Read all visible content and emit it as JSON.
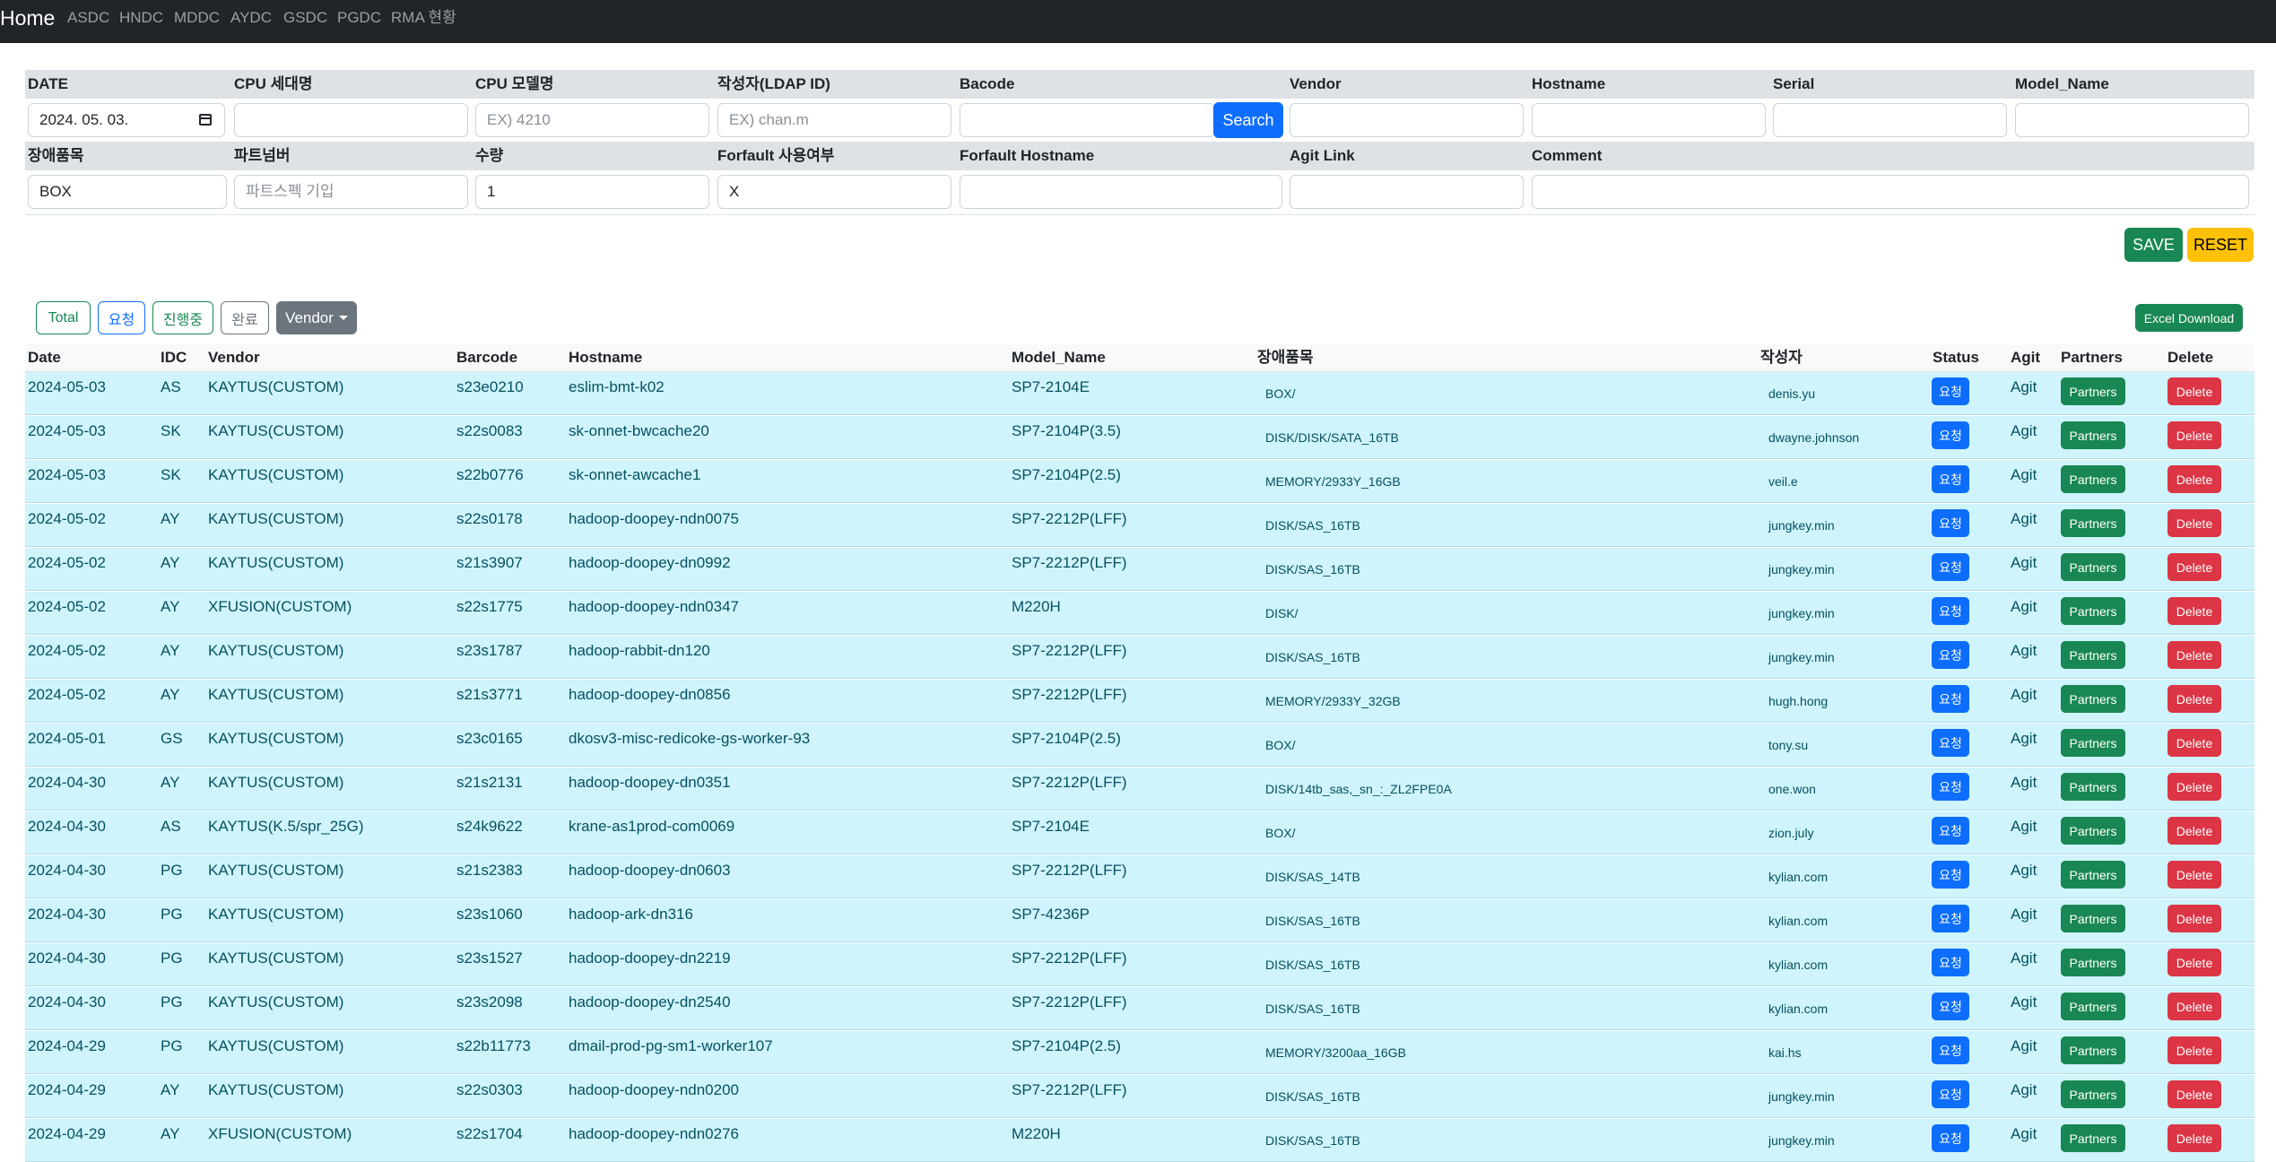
{
  "nav": {
    "home": "Home",
    "links": [
      "ASDC",
      "HNDC",
      "MDDC",
      "AYDC",
      "GSDC",
      "PGDC",
      "RMA 현황"
    ]
  },
  "form": {
    "row1": {
      "date": {
        "label": "DATE",
        "value": "2024. 05. 03."
      },
      "cpu_gen": {
        "label": "CPU 세대명",
        "value": "",
        "placeholder": ""
      },
      "cpu_model": {
        "label": "CPU 모델명",
        "value": "",
        "placeholder": "EX) 4210"
      },
      "author": {
        "label": "작성자(LDAP ID)",
        "value": "",
        "placeholder": "EX) chan.m"
      },
      "barcode": {
        "label": "Bacode",
        "value": "",
        "placeholder": ""
      },
      "vendor": {
        "label": "Vendor",
        "value": "",
        "placeholder": ""
      },
      "hostname": {
        "label": "Hostname",
        "value": "",
        "placeholder": ""
      },
      "serial": {
        "label": "Serial",
        "value": "",
        "placeholder": ""
      },
      "model_name": {
        "label": "Model_Name",
        "value": "",
        "placeholder": ""
      }
    },
    "row2": {
      "fault_item": {
        "label": "장애품목",
        "value": "BOX"
      },
      "part_number": {
        "label": "파트넘버",
        "value": "",
        "placeholder": "파트스펙 기입"
      },
      "quantity": {
        "label": "수량",
        "value": "1"
      },
      "forfault_use": {
        "label": "Forfault 사용여부",
        "value": "X"
      },
      "forfault_hostname": {
        "label": "Forfault Hostname",
        "value": "",
        "placeholder": ""
      },
      "agit_link": {
        "label": "Agit Link",
        "value": "",
        "placeholder": ""
      },
      "comment": {
        "label": "Comment",
        "value": "",
        "placeholder": ""
      }
    },
    "search_button": "Search",
    "save_button": "SAVE",
    "reset_button": "RESET"
  },
  "filters": {
    "total": "Total",
    "requested": "요청",
    "in_progress": "진행중",
    "done": "완료",
    "vendor": "Vendor",
    "excel": "Excel Download"
  },
  "table": {
    "headers": {
      "date": "Date",
      "idc": "IDC",
      "vendor": "Vendor",
      "barcode": "Barcode",
      "hostname": "Hostname",
      "model": "Model_Name",
      "fault": "장애품목",
      "author": "작성자",
      "status": "Status",
      "agit": "Agit",
      "partners": "Partners",
      "delete": "Delete"
    },
    "rows": [
      {
        "date": "2024-05-03",
        "idc": "AS",
        "vendor": "KAYTUS(CUSTOM)",
        "barcode": "s23e0210",
        "hostname": "eslim-bmt-k02",
        "model": "SP7-2104E",
        "fault": "BOX/",
        "author": "denis.yu",
        "status": "요청",
        "agit": "Agit",
        "partners": "Partners",
        "delete": "Delete"
      },
      {
        "date": "2024-05-03",
        "idc": "SK",
        "vendor": "KAYTUS(CUSTOM)",
        "barcode": "s22s0083",
        "hostname": "sk-onnet-bwcache20",
        "model": "SP7-2104P(3.5)",
        "fault": "DISK/DISK/SATA_16TB",
        "author": "dwayne.johnson",
        "status": "요청",
        "agit": "Agit",
        "partners": "Partners",
        "delete": "Delete"
      },
      {
        "date": "2024-05-03",
        "idc": "SK",
        "vendor": "KAYTUS(CUSTOM)",
        "barcode": "s22b0776",
        "hostname": "sk-onnet-awcache1",
        "model": "SP7-2104P(2.5)",
        "fault": "MEMORY/2933Y_16GB",
        "author": "veil.e",
        "status": "요청",
        "agit": "Agit",
        "partners": "Partners",
        "delete": "Delete"
      },
      {
        "date": "2024-05-02",
        "idc": "AY",
        "vendor": "KAYTUS(CUSTOM)",
        "barcode": "s22s0178",
        "hostname": "hadoop-doopey-ndn0075",
        "model": "SP7-2212P(LFF)",
        "fault": "DISK/SAS_16TB",
        "author": "jungkey.min",
        "status": "요청",
        "agit": "Agit",
        "partners": "Partners",
        "delete": "Delete"
      },
      {
        "date": "2024-05-02",
        "idc": "AY",
        "vendor": "KAYTUS(CUSTOM)",
        "barcode": "s21s3907",
        "hostname": "hadoop-doopey-dn0992",
        "model": "SP7-2212P(LFF)",
        "fault": "DISK/SAS_16TB",
        "author": "jungkey.min",
        "status": "요청",
        "agit": "Agit",
        "partners": "Partners",
        "delete": "Delete"
      },
      {
        "date": "2024-05-02",
        "idc": "AY",
        "vendor": "XFUSION(CUSTOM)",
        "barcode": "s22s1775",
        "hostname": "hadoop-doopey-ndn0347",
        "model": "M220H",
        "fault": "DISK/",
        "author": "jungkey.min",
        "status": "요청",
        "agit": "Agit",
        "partners": "Partners",
        "delete": "Delete"
      },
      {
        "date": "2024-05-02",
        "idc": "AY",
        "vendor": "KAYTUS(CUSTOM)",
        "barcode": "s23s1787",
        "hostname": "hadoop-rabbit-dn120",
        "model": "SP7-2212P(LFF)",
        "fault": "DISK/SAS_16TB",
        "author": "jungkey.min",
        "status": "요청",
        "agit": "Agit",
        "partners": "Partners",
        "delete": "Delete"
      },
      {
        "date": "2024-05-02",
        "idc": "AY",
        "vendor": "KAYTUS(CUSTOM)",
        "barcode": "s21s3771",
        "hostname": "hadoop-doopey-dn0856",
        "model": "SP7-2212P(LFF)",
        "fault": "MEMORY/2933Y_32GB",
        "author": "hugh.hong",
        "status": "요청",
        "agit": "Agit",
        "partners": "Partners",
        "delete": "Delete"
      },
      {
        "date": "2024-05-01",
        "idc": "GS",
        "vendor": "KAYTUS(CUSTOM)",
        "barcode": "s23c0165",
        "hostname": "dkosv3-misc-redicoke-gs-worker-93",
        "model": "SP7-2104P(2.5)",
        "fault": "BOX/",
        "author": "tony.su",
        "status": "요청",
        "agit": "Agit",
        "partners": "Partners",
        "delete": "Delete"
      },
      {
        "date": "2024-04-30",
        "idc": "AY",
        "vendor": "KAYTUS(CUSTOM)",
        "barcode": "s21s2131",
        "hostname": "hadoop-doopey-dn0351",
        "model": "SP7-2212P(LFF)",
        "fault": "DISK/14tb_sas,_sn_:_ZL2FPE0A",
        "author": "one.won",
        "status": "요청",
        "agit": "Agit",
        "partners": "Partners",
        "delete": "Delete"
      },
      {
        "date": "2024-04-30",
        "idc": "AS",
        "vendor": "KAYTUS(K.5/spr_25G)",
        "barcode": "s24k9622",
        "hostname": "krane-as1prod-com0069",
        "model": "SP7-2104E",
        "fault": "BOX/",
        "author": "zion.july",
        "status": "요청",
        "agit": "Agit",
        "partners": "Partners",
        "delete": "Delete"
      },
      {
        "date": "2024-04-30",
        "idc": "PG",
        "vendor": "KAYTUS(CUSTOM)",
        "barcode": "s21s2383",
        "hostname": "hadoop-doopey-dn0603",
        "model": "SP7-2212P(LFF)",
        "fault": "DISK/SAS_14TB",
        "author": "kylian.com",
        "status": "요청",
        "agit": "Agit",
        "partners": "Partners",
        "delete": "Delete"
      },
      {
        "date": "2024-04-30",
        "idc": "PG",
        "vendor": "KAYTUS(CUSTOM)",
        "barcode": "s23s1060",
        "hostname": "hadoop-ark-dn316",
        "model": "SP7-4236P",
        "fault": "DISK/SAS_16TB",
        "author": "kylian.com",
        "status": "요청",
        "agit": "Agit",
        "partners": "Partners",
        "delete": "Delete"
      },
      {
        "date": "2024-04-30",
        "idc": "PG",
        "vendor": "KAYTUS(CUSTOM)",
        "barcode": "s23s1527",
        "hostname": "hadoop-doopey-dn2219",
        "model": "SP7-2212P(LFF)",
        "fault": "DISK/SAS_16TB",
        "author": "kylian.com",
        "status": "요청",
        "agit": "Agit",
        "partners": "Partners",
        "delete": "Delete"
      },
      {
        "date": "2024-04-30",
        "idc": "PG",
        "vendor": "KAYTUS(CUSTOM)",
        "barcode": "s23s2098",
        "hostname": "hadoop-doopey-dn2540",
        "model": "SP7-2212P(LFF)",
        "fault": "DISK/SAS_16TB",
        "author": "kylian.com",
        "status": "요청",
        "agit": "Agit",
        "partners": "Partners",
        "delete": "Delete"
      },
      {
        "date": "2024-04-29",
        "idc": "PG",
        "vendor": "KAYTUS(CUSTOM)",
        "barcode": "s22b11773",
        "hostname": "dmail-prod-pg-sm1-worker107",
        "model": "SP7-2104P(2.5)",
        "fault": "MEMORY/3200aa_16GB",
        "author": "kai.hs",
        "status": "요청",
        "agit": "Agit",
        "partners": "Partners",
        "delete": "Delete"
      },
      {
        "date": "2024-04-29",
        "idc": "AY",
        "vendor": "KAYTUS(CUSTOM)",
        "barcode": "s22s0303",
        "hostname": "hadoop-doopey-ndn0200",
        "model": "SP7-2212P(LFF)",
        "fault": "DISK/SAS_16TB",
        "author": "jungkey.min",
        "status": "요청",
        "agit": "Agit",
        "partners": "Partners",
        "delete": "Delete"
      },
      {
        "date": "2024-04-29",
        "idc": "AY",
        "vendor": "XFUSION(CUSTOM)",
        "barcode": "s22s1704",
        "hostname": "hadoop-doopey-ndn0276",
        "model": "M220H",
        "fault": "DISK/SAS_16TB",
        "author": "jungkey.min",
        "status": "요청",
        "agit": "Agit",
        "partners": "Partners",
        "delete": "Delete"
      }
    ]
  },
  "colors": {
    "navbar": "#212529",
    "row_bg": "#cff4fc",
    "primary": "#0d6efd",
    "success": "#198754",
    "danger": "#dc3545",
    "warning": "#ffc107",
    "secondary": "#6c757d"
  }
}
